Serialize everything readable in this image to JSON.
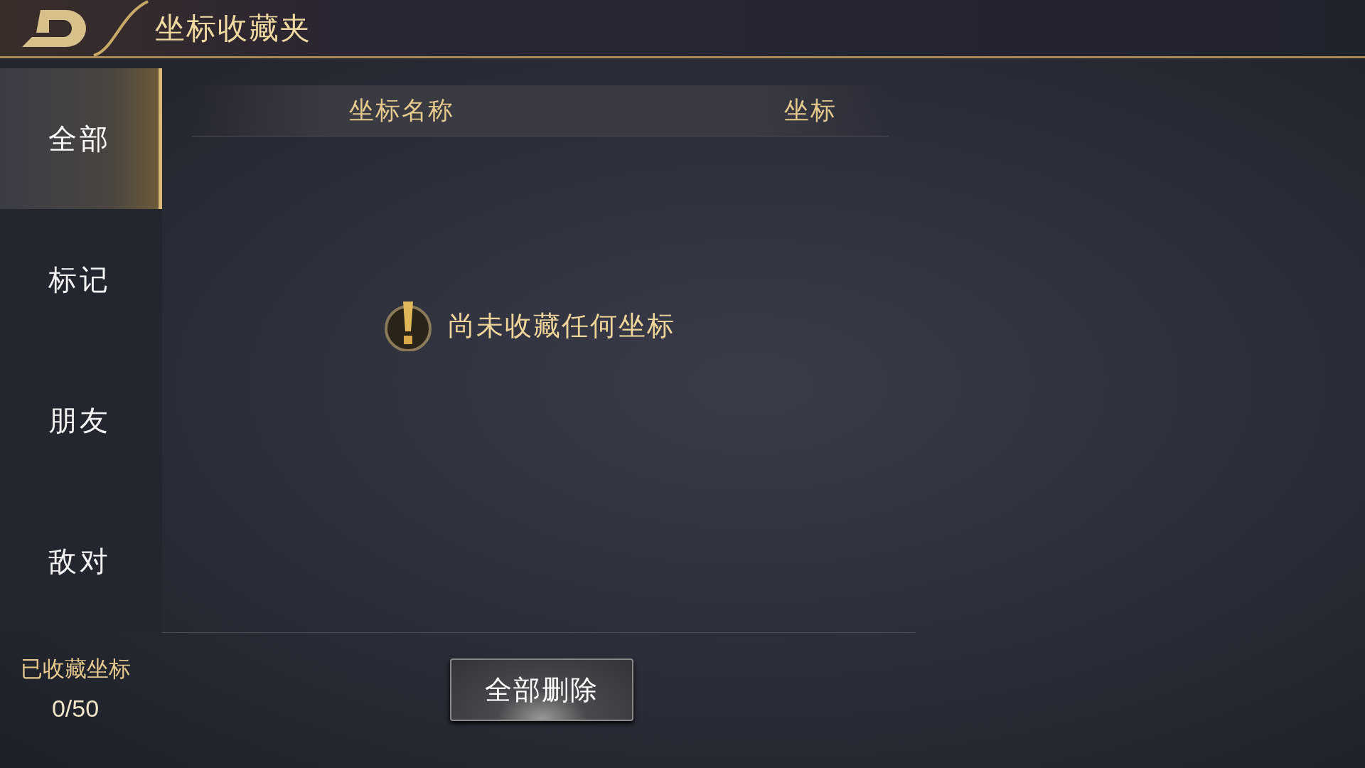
{
  "header": {
    "title": "坐标收藏夹"
  },
  "tabs": [
    {
      "label": "全部",
      "selected": true
    },
    {
      "label": "标记",
      "selected": false
    },
    {
      "label": "朋友",
      "selected": false
    },
    {
      "label": "敌对",
      "selected": false
    }
  ],
  "table": {
    "columns": [
      "坐标名称",
      "坐标"
    ]
  },
  "empty_message": "尚未收藏任何坐标",
  "saved_count": {
    "label": "已收藏坐标",
    "value": "0/50"
  },
  "buttons": [
    "全部删除"
  ]
}
